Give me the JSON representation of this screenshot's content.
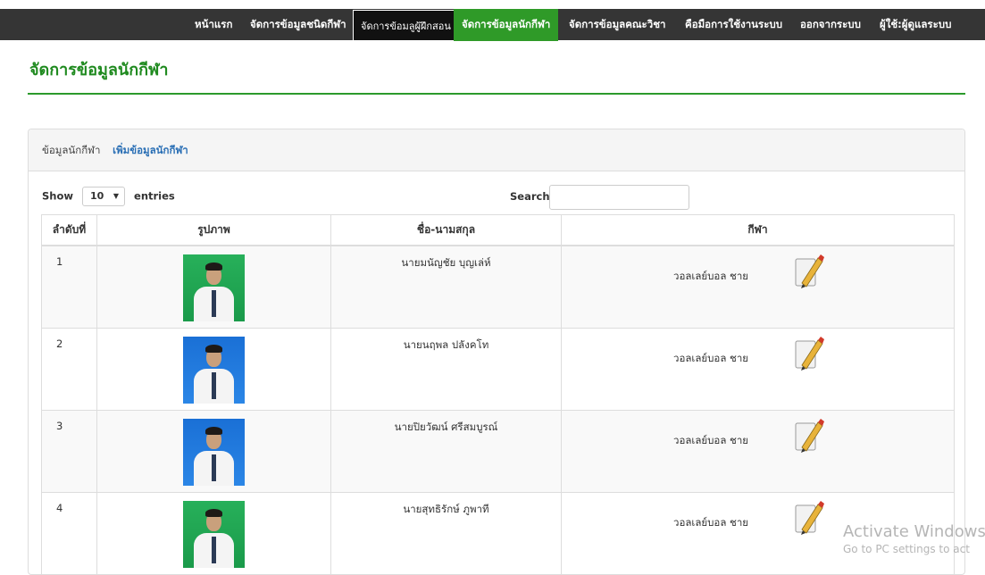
{
  "nav": {
    "items": [
      {
        "label": "หน้าแรก"
      },
      {
        "label": "จัดการข้อมูลชนิดกีฬา"
      },
      {
        "label": "จัดการข้อมลูผู้ฝึกสอน"
      },
      {
        "label": "จัดการข้อมูลนักกีฬา"
      },
      {
        "label": "จัดการข้อมูลคณะวิชา"
      },
      {
        "label": "คือมือการใช้งานระบบ"
      },
      {
        "label": "ออกจากระบบ"
      },
      {
        "label": "ผู้ใช้:ผู้ดูแลระบบ"
      }
    ],
    "active_color": "#2f9a28",
    "bar_color": "#353535"
  },
  "page": {
    "title": "จัดการข้อมูลนักกีฬา",
    "accent": "#1f8a1f"
  },
  "panel": {
    "heading_label": "ข้อมูลนักกีฬา",
    "add_link": "เพิ่มข้อมูลนักกีฬา"
  },
  "table_controls": {
    "show_label": "Show",
    "entries_value": "10",
    "entries_label": "entries",
    "search_label": "Search:",
    "search_value": ""
  },
  "table": {
    "headers": [
      "ลำดับที่",
      "รูปภาพ",
      "ชื่อ-นามสกุล",
      "กีฬา"
    ],
    "rows": [
      {
        "num": "1",
        "photo_bg": "green",
        "name": "นายมนัญชัย บุญเล่ห์",
        "sport": "วอลเลย์บอล ชาย"
      },
      {
        "num": "2",
        "photo_bg": "blue",
        "name": "นายนฤพล ปลังคโท",
        "sport": "วอลเลย์บอล ชาย"
      },
      {
        "num": "3",
        "photo_bg": "blue",
        "name": "นายปิยวัฒน์ ศรีสมบูรณ์",
        "sport": "วอลเลย์บอล ชาย"
      },
      {
        "num": "4",
        "photo_bg": "green",
        "name": "นายสุทธิรักษ์ ภูพาที",
        "sport": "วอลเลย์บอล ชาย"
      }
    ]
  },
  "watermark": {
    "line1": "Activate Windows",
    "line2": "Go to PC settings to act"
  }
}
